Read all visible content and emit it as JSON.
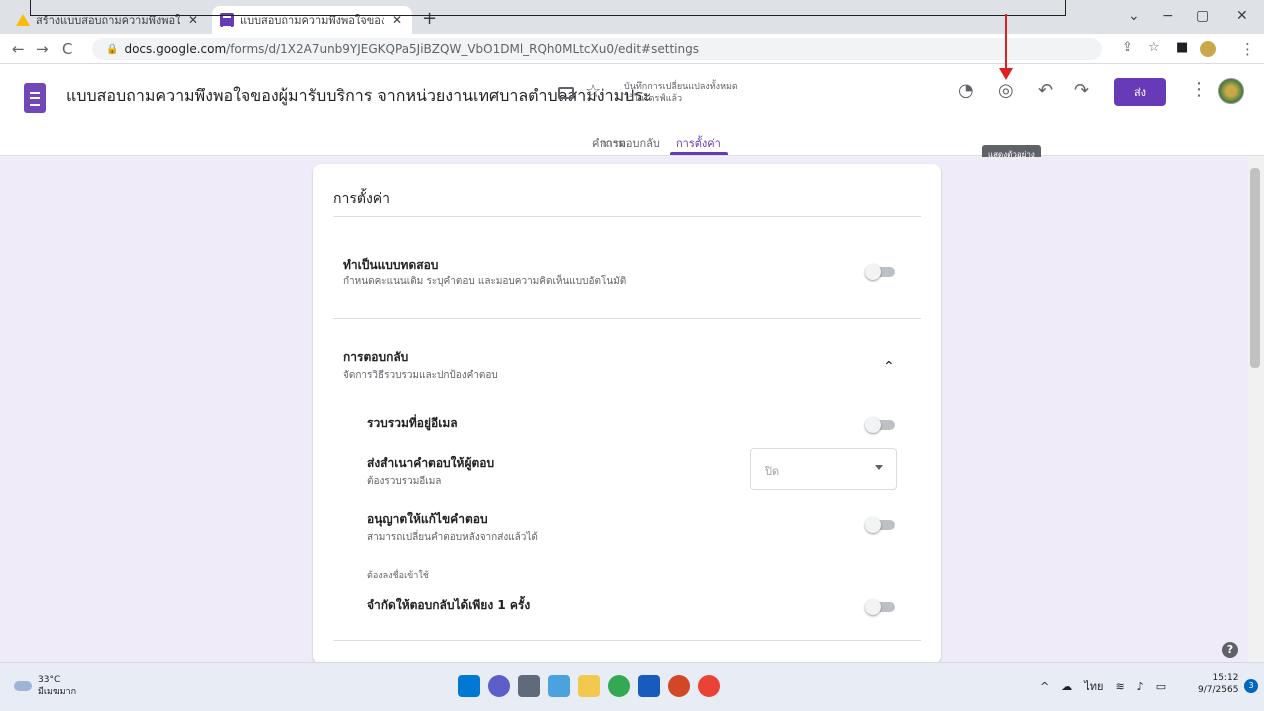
{
  "browser": {
    "tabs": [
      {
        "title": "สร้างแบบสอบถามความพึงพอใจ - Goo",
        "close": "✕"
      },
      {
        "title": "แบบสอบถามความพึงพอใจของผู้มารับบ",
        "close": "✕"
      }
    ],
    "new_tab": "+",
    "window_controls": {
      "minimize": "−",
      "maximize": "▢",
      "close": "✕",
      "dropdown": "⌄"
    },
    "nav": {
      "back": "←",
      "forward": "→",
      "reload": "C"
    },
    "url_host": "docs.google.com",
    "url_path": "/forms/d/1X2A7unb9YJEGKQPa5JiBZQW_VbO1DMl_RQh0MLtcXu0/edit#settings",
    "toolbar_icons": {
      "share": "⇪",
      "bookmark": "☆",
      "sidepanel": "■"
    }
  },
  "forms_header": {
    "title": "แบบสอบถามความพึงพอใจของผู้มารับบริการ จากหน่วยงานเทศบาลตำบลสามง่ามประ",
    "star": "☆",
    "saved_line1": "บันทึกการเปลี่ยนแปลงทั้งหมด",
    "saved_line2": "ไว้ในไดรฟ์แล้ว",
    "palette_icon": "◔",
    "preview_icon": "◎",
    "undo_icon": "↶",
    "redo_icon": "↷",
    "send_label": "ส่ง",
    "more_icon": "⋮",
    "preview_tooltip": "แสดงตัวอย่าง",
    "tabs": [
      "คำถาม",
      "การตอบกลับ",
      "การตั้งค่า"
    ]
  },
  "settings": {
    "heading": "การตั้งค่า",
    "quiz_title": "ทำเป็นแบบทดสอบ",
    "quiz_desc": "กำหนดคะแนนเดิม ระบุคำตอบ และมอบความคิดเห็นแบบอัตโนมัติ",
    "responses_title": "การตอบกลับ",
    "responses_desc": "จัดการวิธีรวบรวมและปกป้องคำตอบ",
    "chevron": "⌃",
    "collect_email": "รวบรวมที่อยู่อีเมล",
    "send_copy_title": "ส่งสำเนาคำตอบให้ผู้ตอบ",
    "send_copy_desc": "ต้องรวบรวมอีเมล",
    "send_copy_value": "ปิด",
    "allow_edit_title": "อนุญาตให้แก้ไขคำตอบ",
    "allow_edit_desc": "สามารถเปลี่ยนคำตอบหลังจากส่งแล้วได้",
    "requires_signin": "ต้องลงชื่อเข้าใช้",
    "limit_one_title": "จำกัดให้ตอบกลับได้เพียง 1 ครั้ง"
  },
  "help": "?",
  "taskbar": {
    "temp": "33°C",
    "condition": "มีเมฆมาก",
    "lang": "ไทย",
    "tray_up": "^",
    "time": "15:12",
    "date": "9/7/2565",
    "notifications": "3"
  },
  "colors": {
    "accent": "#673ab7",
    "bg": "#f0ebf8",
    "annotation": "#e02020"
  }
}
